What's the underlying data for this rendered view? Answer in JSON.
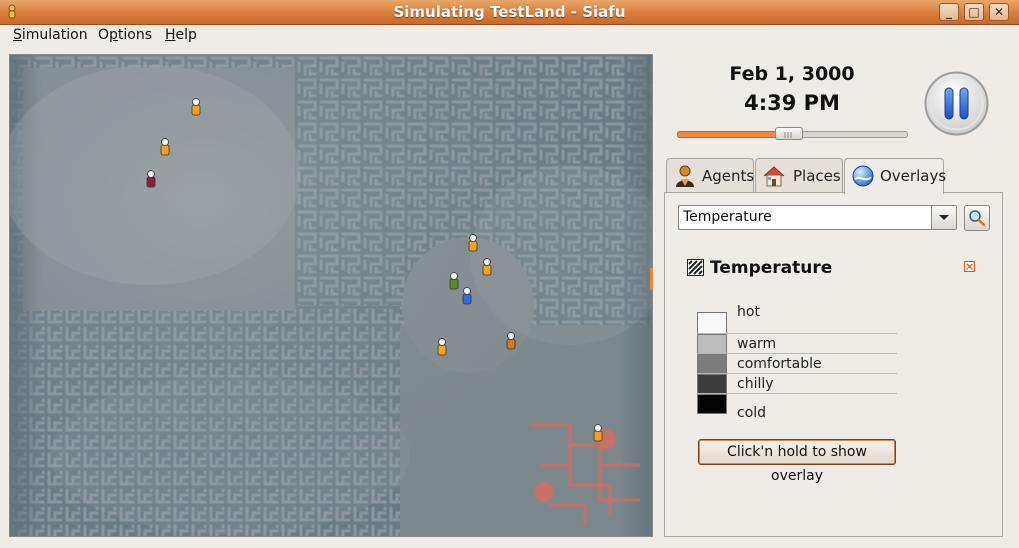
{
  "window": {
    "title": "Simulating TestLand - Siafu",
    "controls": [
      "minimize-icon",
      "maximize-icon",
      "close-icon"
    ]
  },
  "menu": [
    {
      "label": "Simulation",
      "mnemonic": "S",
      "rest": "imulation"
    },
    {
      "label": "Options",
      "mnemonic": "O",
      "rest": "ptions",
      "mnemonic_after": "p",
      "prefix": "O"
    },
    {
      "label": "Help",
      "mnemonic": "H",
      "rest": "elp"
    }
  ],
  "clock": {
    "date": "Feb 1, 3000",
    "time": "4:39 PM"
  },
  "speed": {
    "fraction": 0.49
  },
  "tabs": [
    {
      "label": "Agents",
      "icon": "agent-icon"
    },
    {
      "label": "Places",
      "icon": "house-icon"
    },
    {
      "label": "Overlays",
      "icon": "globe-icon",
      "active": true
    }
  ],
  "overlay": {
    "selected": "Temperature",
    "title": "Temperature",
    "legend": [
      {
        "label": "hot",
        "color": "#fafafa"
      },
      {
        "label": "warm",
        "color": "#bdbdbd"
      },
      {
        "label": "comfortable",
        "color": "#7d7d7d"
      },
      {
        "label": "chilly",
        "color": "#3c3c3c"
      },
      {
        "label": "cold",
        "color": "#050505"
      }
    ],
    "show_button": "Click'n hold to show overlay"
  },
  "colors": {
    "titlebar": "#d77d3d",
    "accent": "#f08a3c",
    "map_fog": "#8d969b",
    "maze_wall": "#546873",
    "place_marker": "#d66a5e"
  },
  "map": {
    "agents": [
      {
        "color": "#f2a21c"
      },
      {
        "color": "#f2a21c"
      },
      {
        "color": "#8a1e3a"
      },
      {
        "color": "#f2a21c"
      },
      {
        "color": "#f2a21c"
      },
      {
        "color": "#5b8a2a"
      },
      {
        "color": "#2f6fd8"
      },
      {
        "color": "#d37a1c"
      },
      {
        "color": "#f2a21c"
      },
      {
        "color": "#f2a21c"
      }
    ]
  }
}
